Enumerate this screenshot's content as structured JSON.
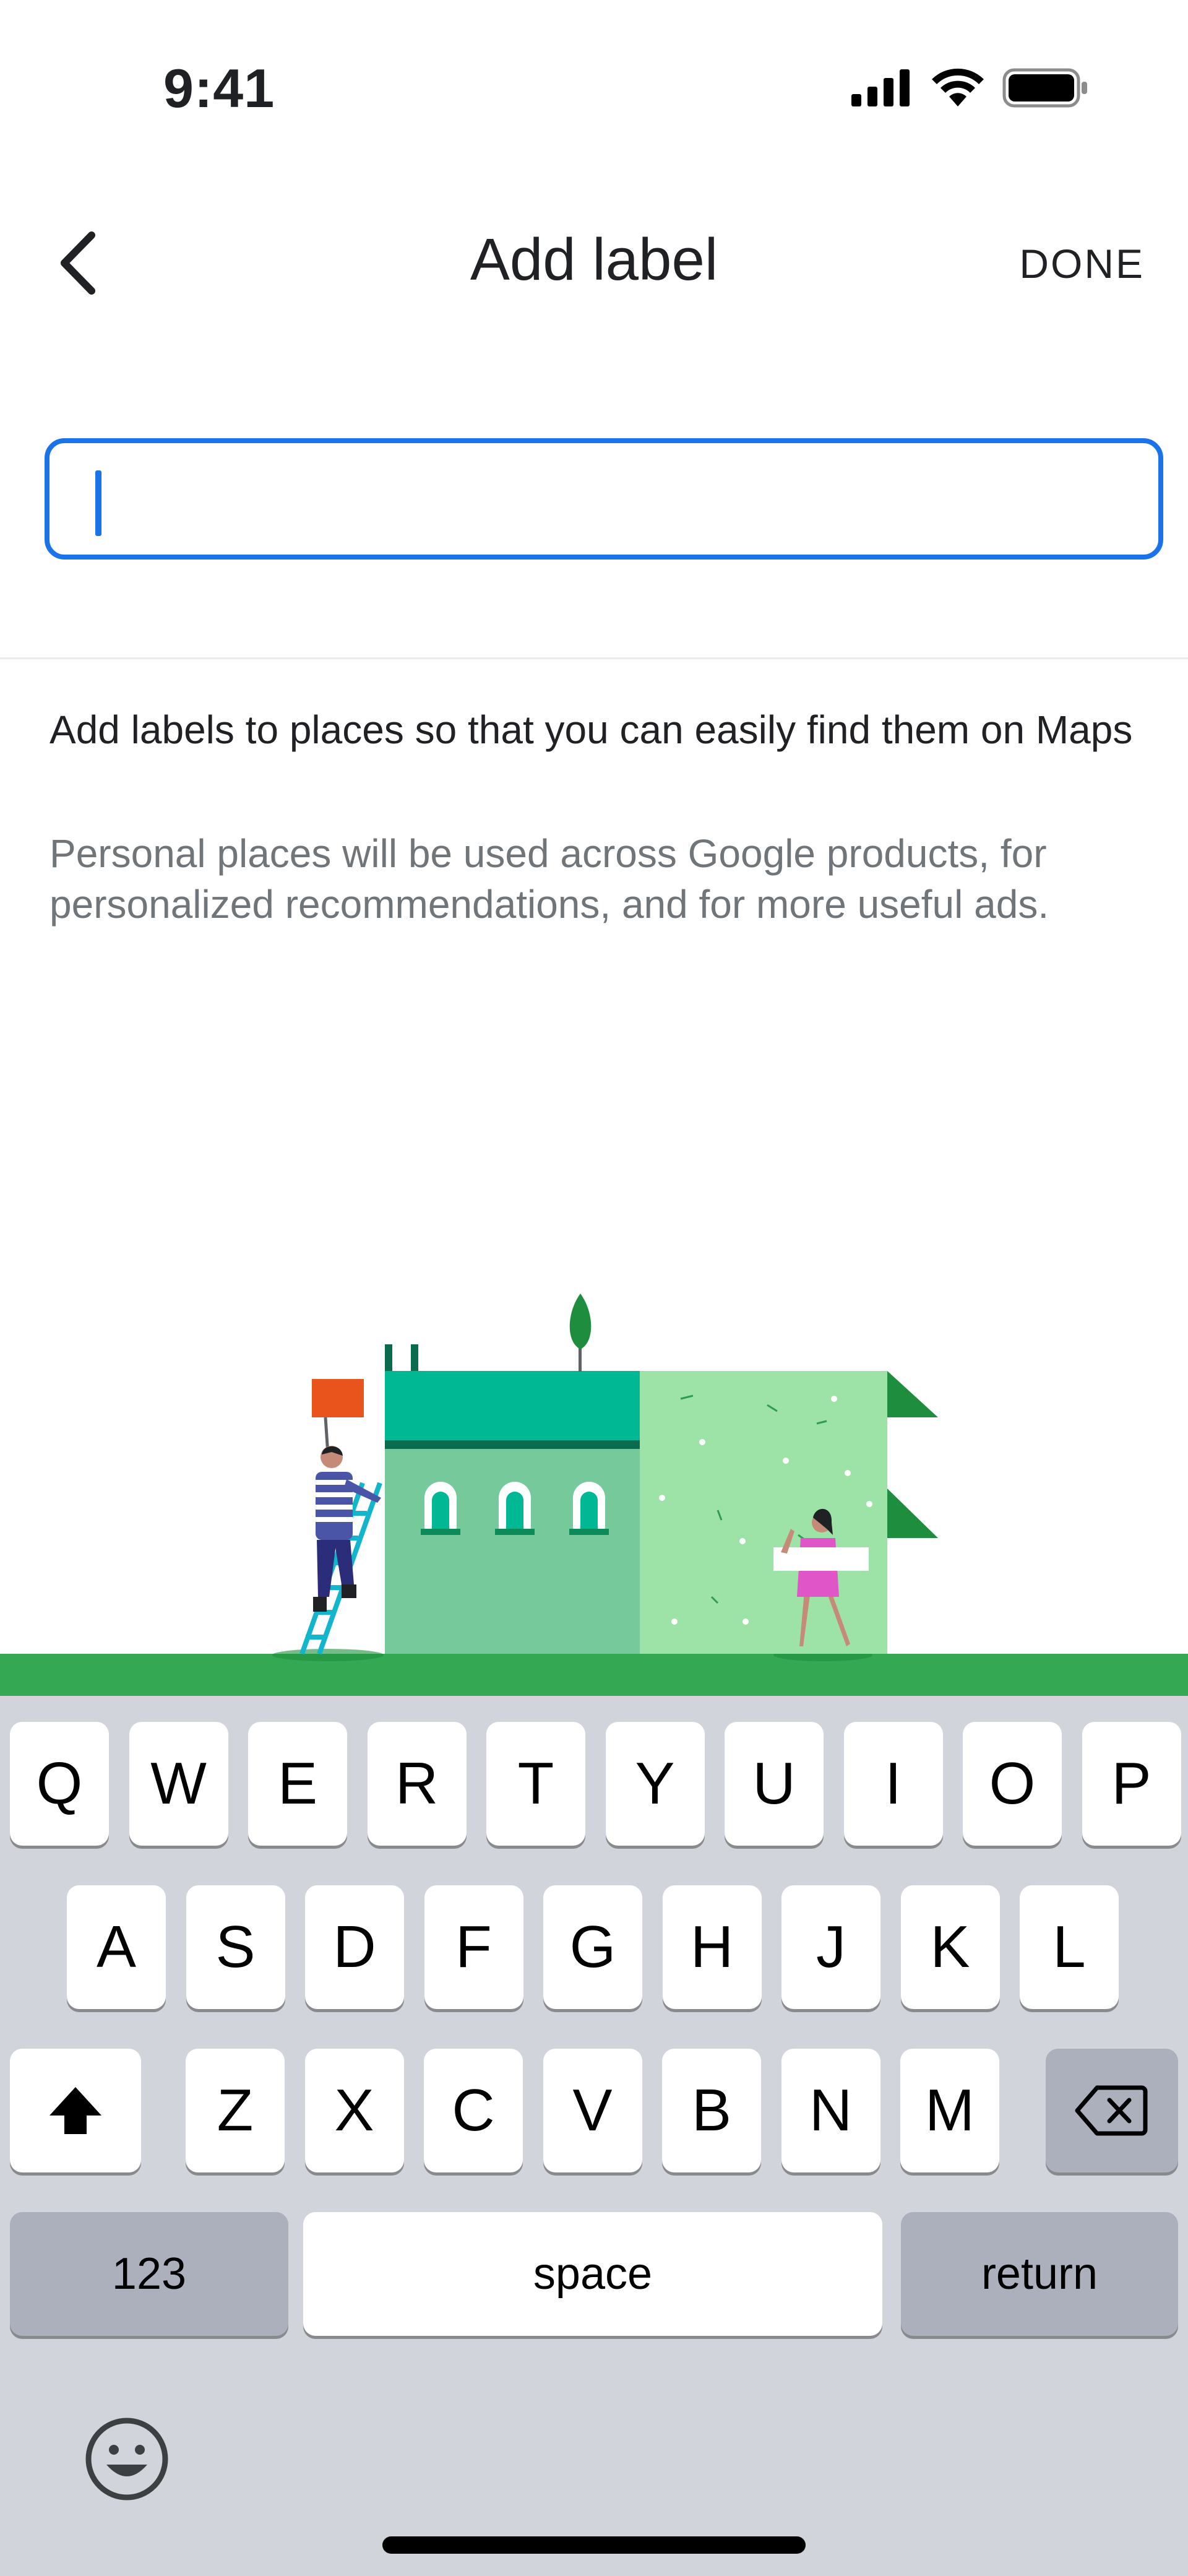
{
  "status_bar": {
    "time": "9:41"
  },
  "header": {
    "title": "Add label",
    "done_label": "DONE"
  },
  "input": {
    "value": "",
    "placeholder": ""
  },
  "info": {
    "heading": "Add labels to places so that you can easily find them on Maps",
    "body": "Personal places will be used across Google products, for personalized recommendations, and for more useful ads."
  },
  "keyboard": {
    "row1": [
      "Q",
      "W",
      "E",
      "R",
      "T",
      "Y",
      "U",
      "I",
      "O",
      "P"
    ],
    "row2": [
      "A",
      "S",
      "D",
      "F",
      "G",
      "H",
      "J",
      "K",
      "L"
    ],
    "row3": [
      "Z",
      "X",
      "C",
      "V",
      "B",
      "N",
      "M"
    ],
    "numbers_label": "123",
    "space_label": "space",
    "return_label": "return"
  },
  "colors": {
    "accent": "#1a73e8",
    "keyboard_bg": "#d1d4db",
    "grass": "#34a853"
  }
}
